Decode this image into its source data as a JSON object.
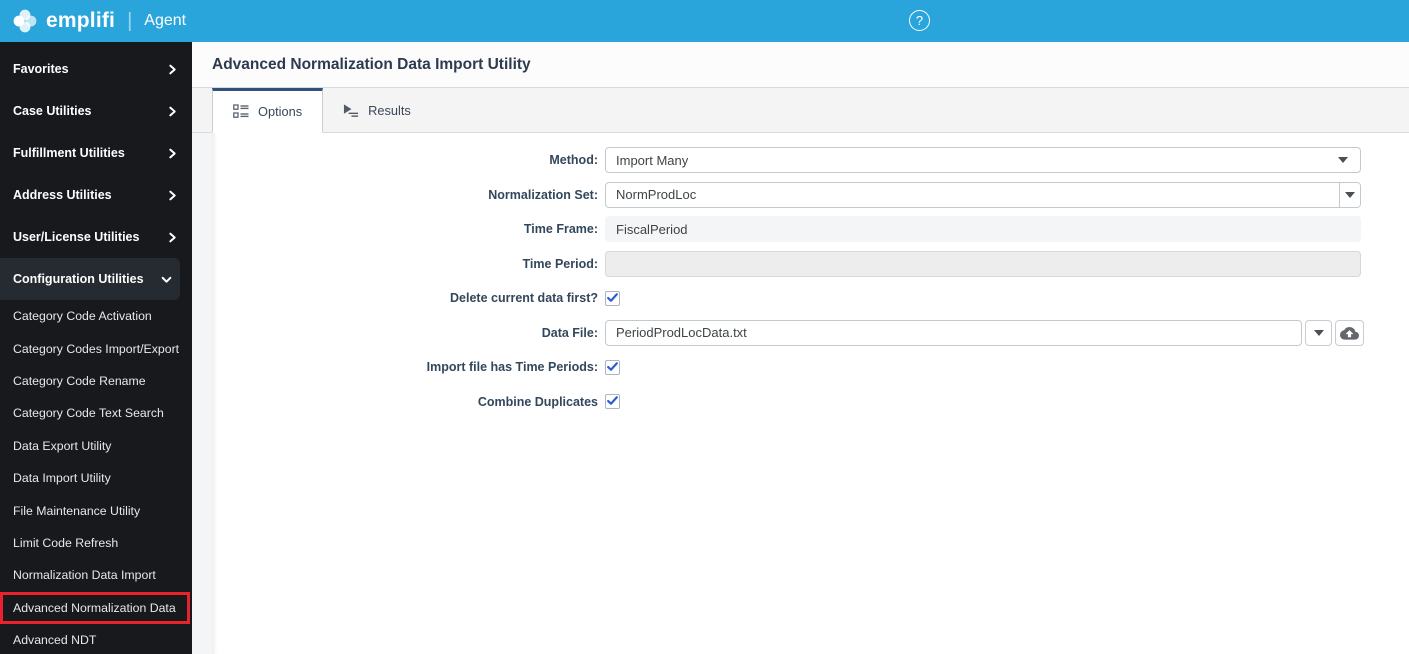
{
  "header": {
    "brand": "emplifi",
    "product": "Agent",
    "help_icon": "?"
  },
  "sidebar": {
    "sections": [
      "Favorites",
      "Case Utilities",
      "Fulfillment Utilities",
      "Address Utilities",
      "User/License Utilities",
      "Configuration Utilities"
    ],
    "expanded_section": "Configuration Utilities",
    "config_items": [
      "Category Code Activation",
      "Category Codes Import/Export",
      "Category Code Rename",
      "Category Code Text Search",
      "Data Export Utility",
      "Data Import Utility",
      "File Maintenance Utility",
      "Limit Code Refresh",
      "Normalization Data Import",
      "Advanced Normalization Data",
      "Advanced NDT"
    ],
    "highlighted_item": "Advanced Normalization Data"
  },
  "main": {
    "title": "Advanced Normalization Data Import Utility",
    "tabs": {
      "options": "Options",
      "results": "Results"
    },
    "form": {
      "method_label": "Method:",
      "method_value": "Import Many",
      "normalization_set_label": "Normalization Set:",
      "normalization_set_value": "NormProdLoc",
      "time_frame_label": "Time Frame:",
      "time_frame_value": "FiscalPeriod",
      "time_period_label": "Time Period:",
      "time_period_value": "",
      "delete_first_label": "Delete current data first?",
      "delete_first_checked": true,
      "data_file_label": "Data File:",
      "data_file_value": "PeriodProdLocData.txt",
      "import_periods_label": "Import file has Time Periods:",
      "import_periods_checked": true,
      "combine_duplicates_label": "Combine Duplicates",
      "combine_duplicates_checked": true
    }
  },
  "colors": {
    "topbar_blue": "#2aa5dc",
    "sidebar_bg": "#17191d",
    "sidebar_active_bg": "#262b31",
    "tab_accent": "#31517d",
    "checkbox_check": "#2d5bd7",
    "annotation_red": "#e8232b"
  }
}
